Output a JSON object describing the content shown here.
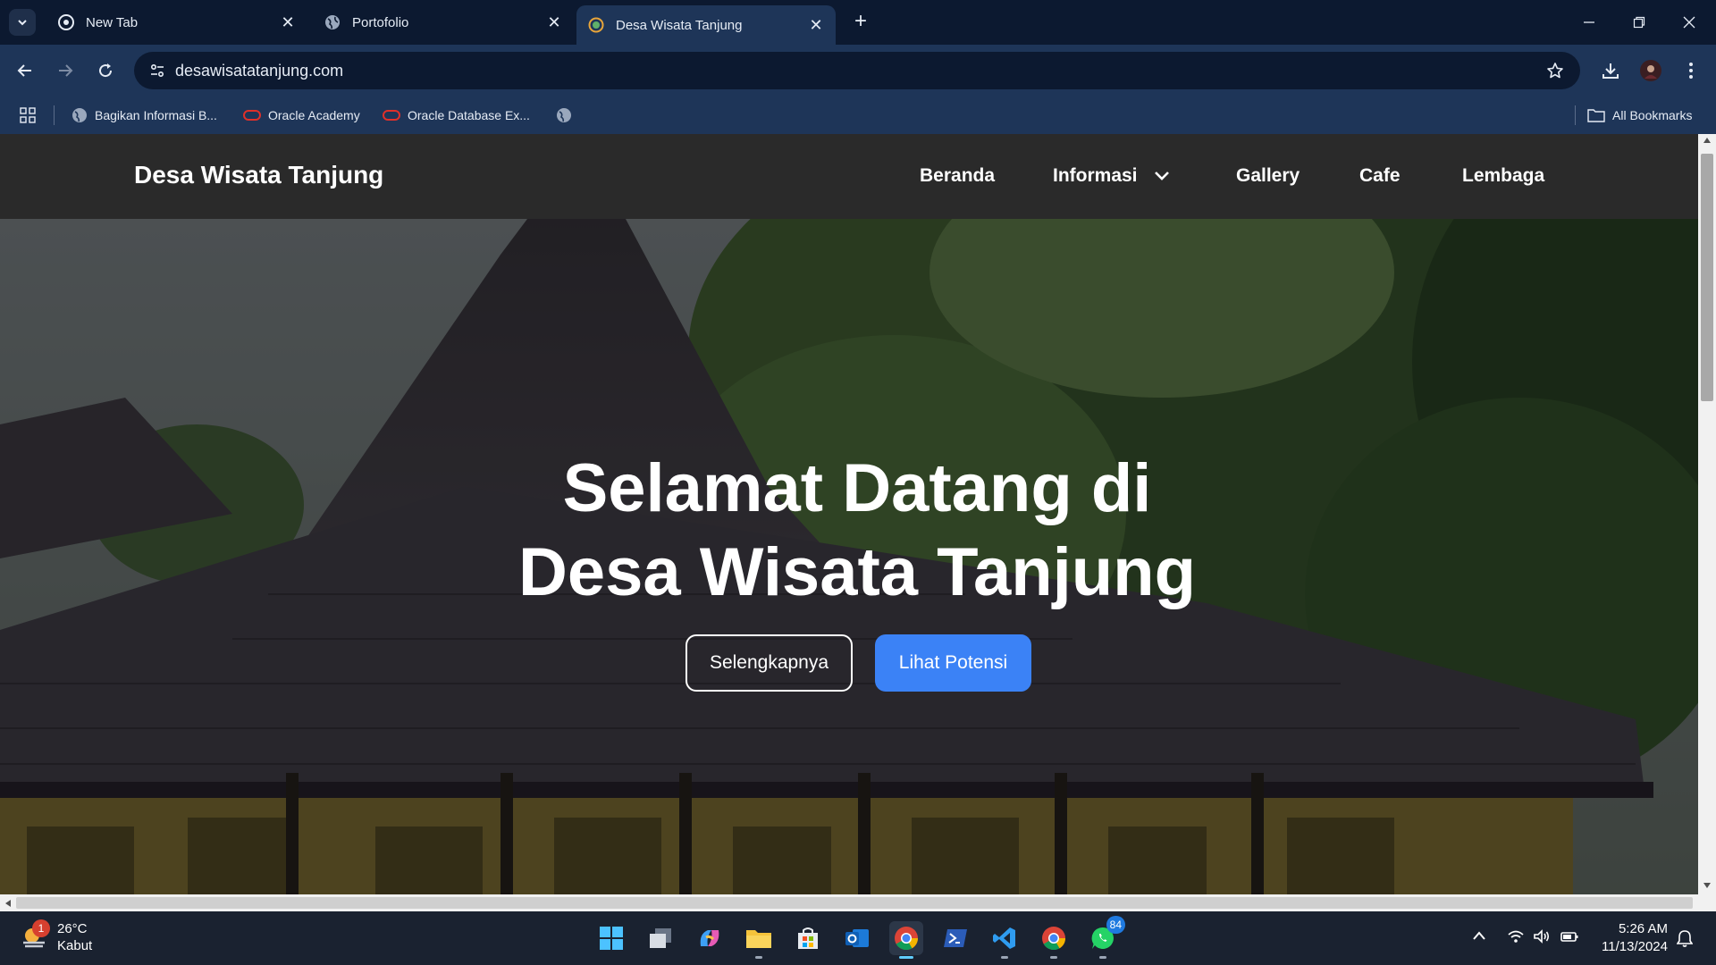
{
  "browser": {
    "tabs": [
      {
        "title": "New Tab",
        "icon": "chrome-icon",
        "active": false
      },
      {
        "title": "Portofolio",
        "icon": "globe-icon",
        "active": false
      },
      {
        "title": "Desa Wisata Tanjung",
        "icon": "site-favicon",
        "active": true
      }
    ],
    "url": "desawisatatanjung.com",
    "bookmarks": [
      {
        "label": "Bagikan Informasi B...",
        "icon": "globe-icon"
      },
      {
        "label": "Oracle Academy",
        "icon": "oracle-icon"
      },
      {
        "label": "Oracle Database Ex...",
        "icon": "oracle-icon"
      },
      {
        "label": "",
        "icon": "globe-icon"
      }
    ],
    "all_bookmarks_label": "All Bookmarks"
  },
  "site": {
    "brand": "Desa Wisata Tanjung",
    "nav": [
      "Beranda",
      "Informasi",
      "Gallery",
      "Cafe",
      "Lembaga"
    ],
    "hero_title_line1": "Selamat Datang di",
    "hero_title_line2": "Desa Wisata Tanjung",
    "btn_more": "Selengkapnya",
    "btn_potential": "Lihat Potensi",
    "accent_color": "#3b82f6",
    "whatsapp_color": "#22c55e"
  },
  "taskbar": {
    "weather_temp": "26°C",
    "weather_desc": "Kabut",
    "weather_badge": "1",
    "whatsapp_badge": "84",
    "time": "5:26 AM",
    "date": "11/13/2024"
  }
}
